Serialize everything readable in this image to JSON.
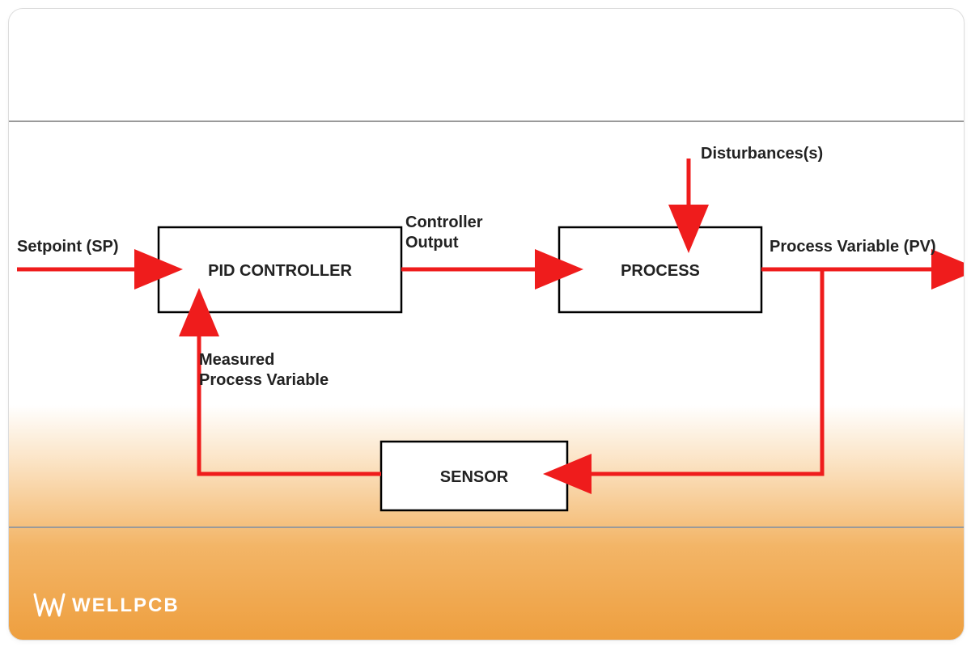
{
  "brand": "WELLPCB",
  "diagram": {
    "blocks": {
      "pid": "PID CONTROLLER",
      "process": "PROCESS",
      "sensor": "SENSOR"
    },
    "labels": {
      "setpoint": "Setpoint (SP)",
      "controller_output_l1": "Controller",
      "controller_output_l2": "Output",
      "disturbances": "Disturbances(s)",
      "process_variable": "Process Variable (PV)",
      "measured_l1": "Measured",
      "measured_l2": "Process Variable"
    }
  },
  "colors": {
    "arrow": "#ef1c1c",
    "gradient_bottom": "#ee9f3f"
  }
}
